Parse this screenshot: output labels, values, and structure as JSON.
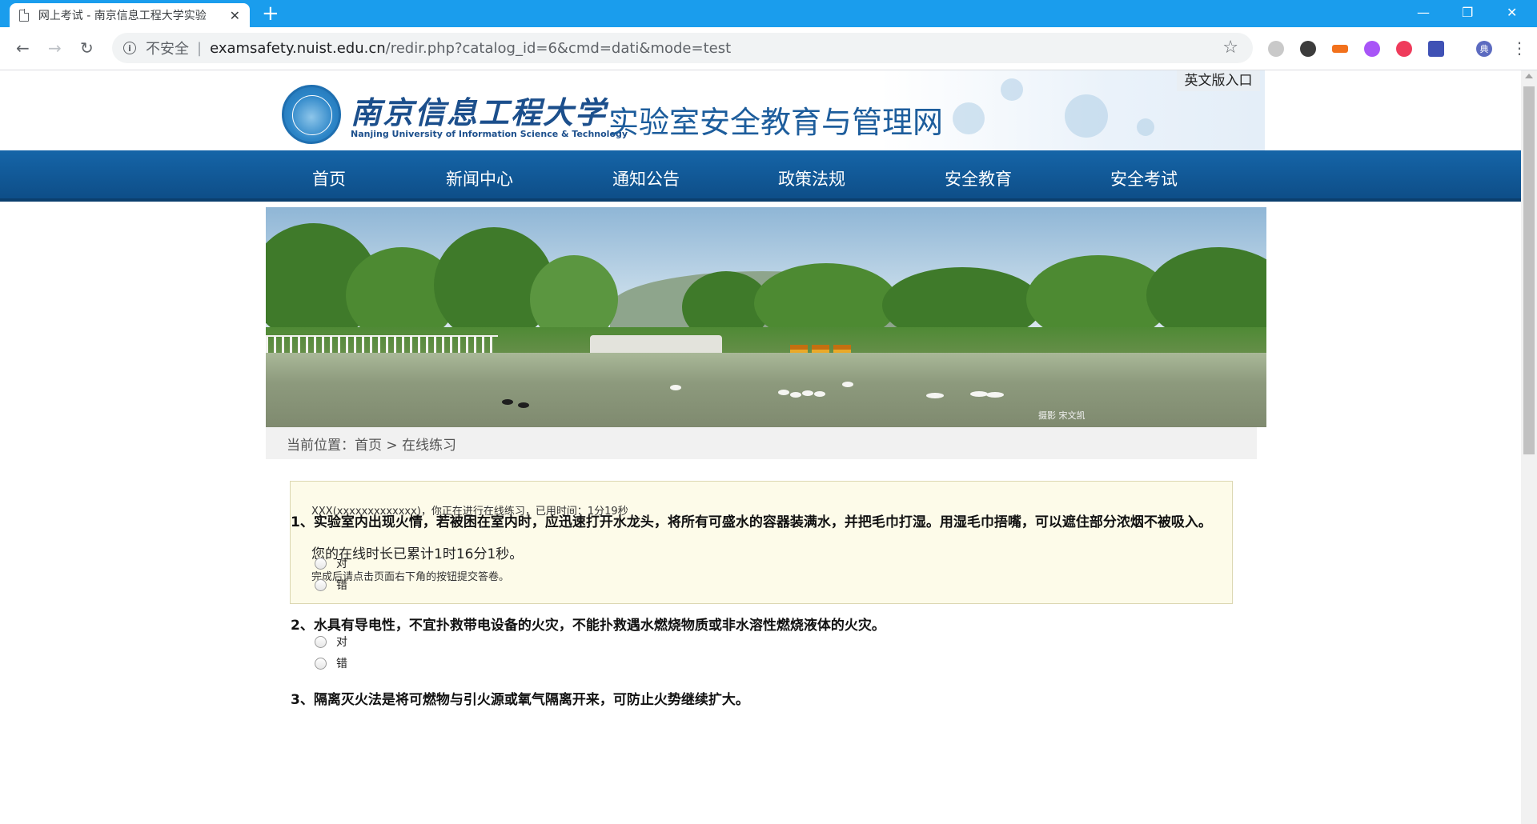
{
  "browser": {
    "tab_title": "网上考试 - 南京信息工程大学实验",
    "tab_close": "✕",
    "new_tab": "+",
    "window_minimize": "—",
    "window_restore": "❐",
    "window_close": "✕",
    "back": "←",
    "forward": "→",
    "reload": "↻",
    "security_label": "不安全",
    "separator": "|",
    "url_host": "examsafety.nuist.edu.cn",
    "url_path": "/redir.php?catalog_id=6&cmd=dati&mode=test",
    "bookmark_star": "☆",
    "extensions": [
      "translate-icon",
      "browser-extension-icon",
      "orange-extension-icon",
      "purple-extension-icon",
      "red-extension-icon",
      "calendar-extension-icon"
    ],
    "profile_initial": "典",
    "menu": "⋮",
    "accent_color": "#1a9ded"
  },
  "site": {
    "logo_cn": "南京信息工程大学",
    "logo_en": "Nanjing University of Information Science & Technology",
    "title": "实验室安全教育与管理网",
    "english_entry": "英文版入口",
    "nav": [
      "首页",
      "新闻中心",
      "通知公告",
      "政策法规",
      "安全教育",
      "安全考试"
    ],
    "photo_credit": "摄影 宋文凯",
    "breadcrumb": "当前位置：首页 > 在线练习"
  },
  "info": {
    "line1": "XXX(xxxxxxxxxxxxx)，你正在进行在线练习，已用时间：1分19秒",
    "line2": "您的在线时长已累计1时16分1秒。",
    "line3": "完成后请点击页面右下角的按钮提交答卷。"
  },
  "questions": [
    {
      "text": "1、实验室内出现火情，若被困在室内时，应迅速打开水龙头，将所有可盛水的容器装满水，并把毛巾打湿。用湿毛巾捂嘴，可以遮住部分浓烟不被吸入。",
      "options": [
        "对",
        "错"
      ]
    },
    {
      "text": "2、水具有导电性，不宜扑救带电设备的火灾，不能扑救遇水燃烧物质或非水溶性燃烧液体的火灾。",
      "options": [
        "对",
        "错"
      ]
    },
    {
      "text": "3、隔离灭火法是将可燃物与引火源或氧气隔离开来，可防止火势继续扩大。",
      "options": []
    }
  ]
}
